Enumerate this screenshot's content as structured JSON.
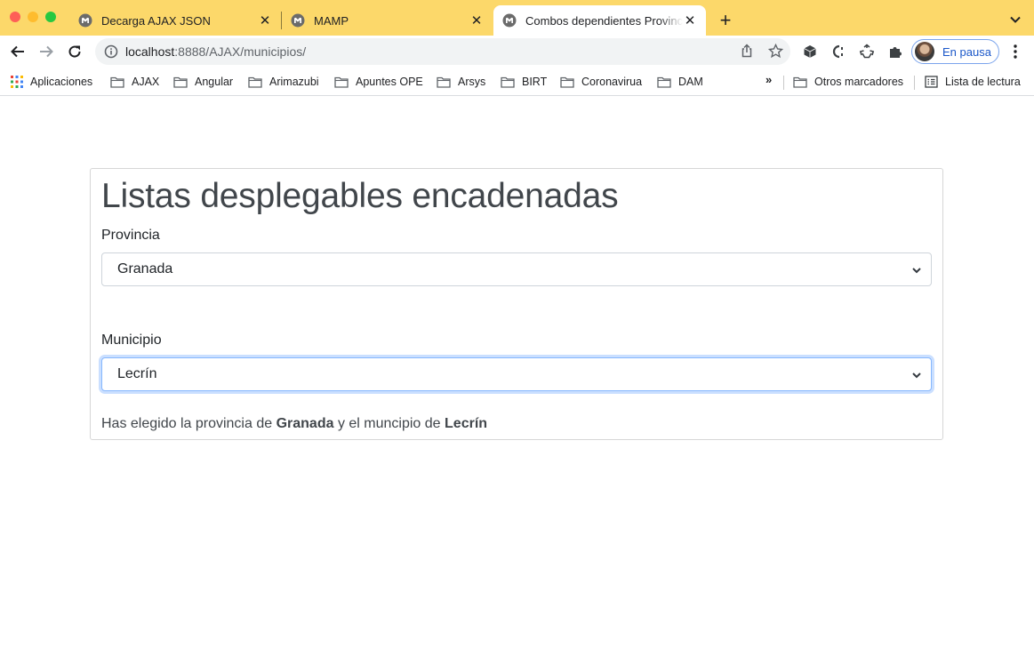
{
  "browser": {
    "tabs": [
      {
        "title": "Decarga AJAX JSON",
        "active": false
      },
      {
        "title": "MAMP",
        "active": false
      },
      {
        "title": "Combos dependientes Provincias",
        "active": true
      }
    ],
    "url_host": "localhost",
    "url_rest": ":8888/AJAX/municipios/",
    "profile_label": "En pausa",
    "bookmarks": [
      "Aplicaciones",
      "AJAX",
      "Angular",
      "Arimazubi",
      "Apuntes OPE",
      "Arsys",
      "BIRT",
      "Coronavirua",
      "DAM"
    ],
    "more_bookmarks": "»",
    "other_bookmarks": "Otros marcadores",
    "reading_list": "Lista de lectura",
    "colors": {
      "tab_strip": "#fcd86a",
      "profile_border": "#7aa4ec"
    }
  },
  "page": {
    "title": "Listas desplegables encadenadas",
    "provincia_label": "Provincia",
    "provincia_value": "Granada",
    "municipio_label": "Municipio",
    "municipio_value": "Lecrín",
    "result_prefix": "Has elegido la provincia de",
    "result_provincia": "Granada",
    "result_middle": "y el muncipio de",
    "result_municipio": "Lecrín"
  }
}
